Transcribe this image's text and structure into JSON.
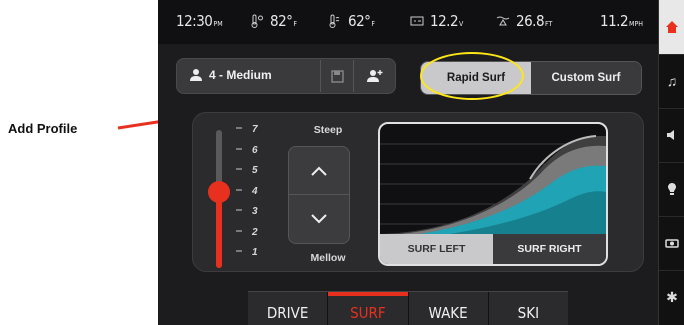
{
  "annotation": {
    "label": "Add Profile",
    "arrow_color": "#e8301f",
    "highlight_color": "#ffe619"
  },
  "status_bar": {
    "time": "12:30",
    "time_suffix": "PM",
    "air_temp": "82°",
    "air_temp_unit": "F",
    "water_temp": "62°",
    "water_temp_unit": "F",
    "battery": "12.2",
    "battery_unit": "V",
    "depth": "26.8",
    "depth_unit": "FT",
    "speed": "11.2",
    "speed_unit": "MPH"
  },
  "profile": {
    "name": "4 - Medium",
    "icons": [
      "user-icon",
      "save-icon",
      "add-user-icon"
    ]
  },
  "surf_mode": {
    "options": [
      "Rapid Surf",
      "Custom Surf"
    ],
    "selected": "Rapid Surf"
  },
  "wave_height": {
    "labels": [
      "7",
      "6",
      "5",
      "4",
      "3",
      "2",
      "1"
    ],
    "value": 4,
    "top_label": "Steep",
    "bottom_label": "Mellow"
  },
  "wave_side": {
    "left_label": "SURF LEFT",
    "right_label": "SURF RIGHT",
    "selected": "SURF LEFT"
  },
  "modes": {
    "items": [
      "DRIVE",
      "SURF",
      "WAKE",
      "SKI"
    ],
    "selected": "SURF"
  },
  "sidebar": {
    "icons": [
      "home-icon",
      "music-icon",
      "speaker-icon",
      "light-icon",
      "camera-icon",
      "settings-icon"
    ]
  },
  "colors": {
    "accent": "#e8301f",
    "teal": "#1fa3b5"
  }
}
